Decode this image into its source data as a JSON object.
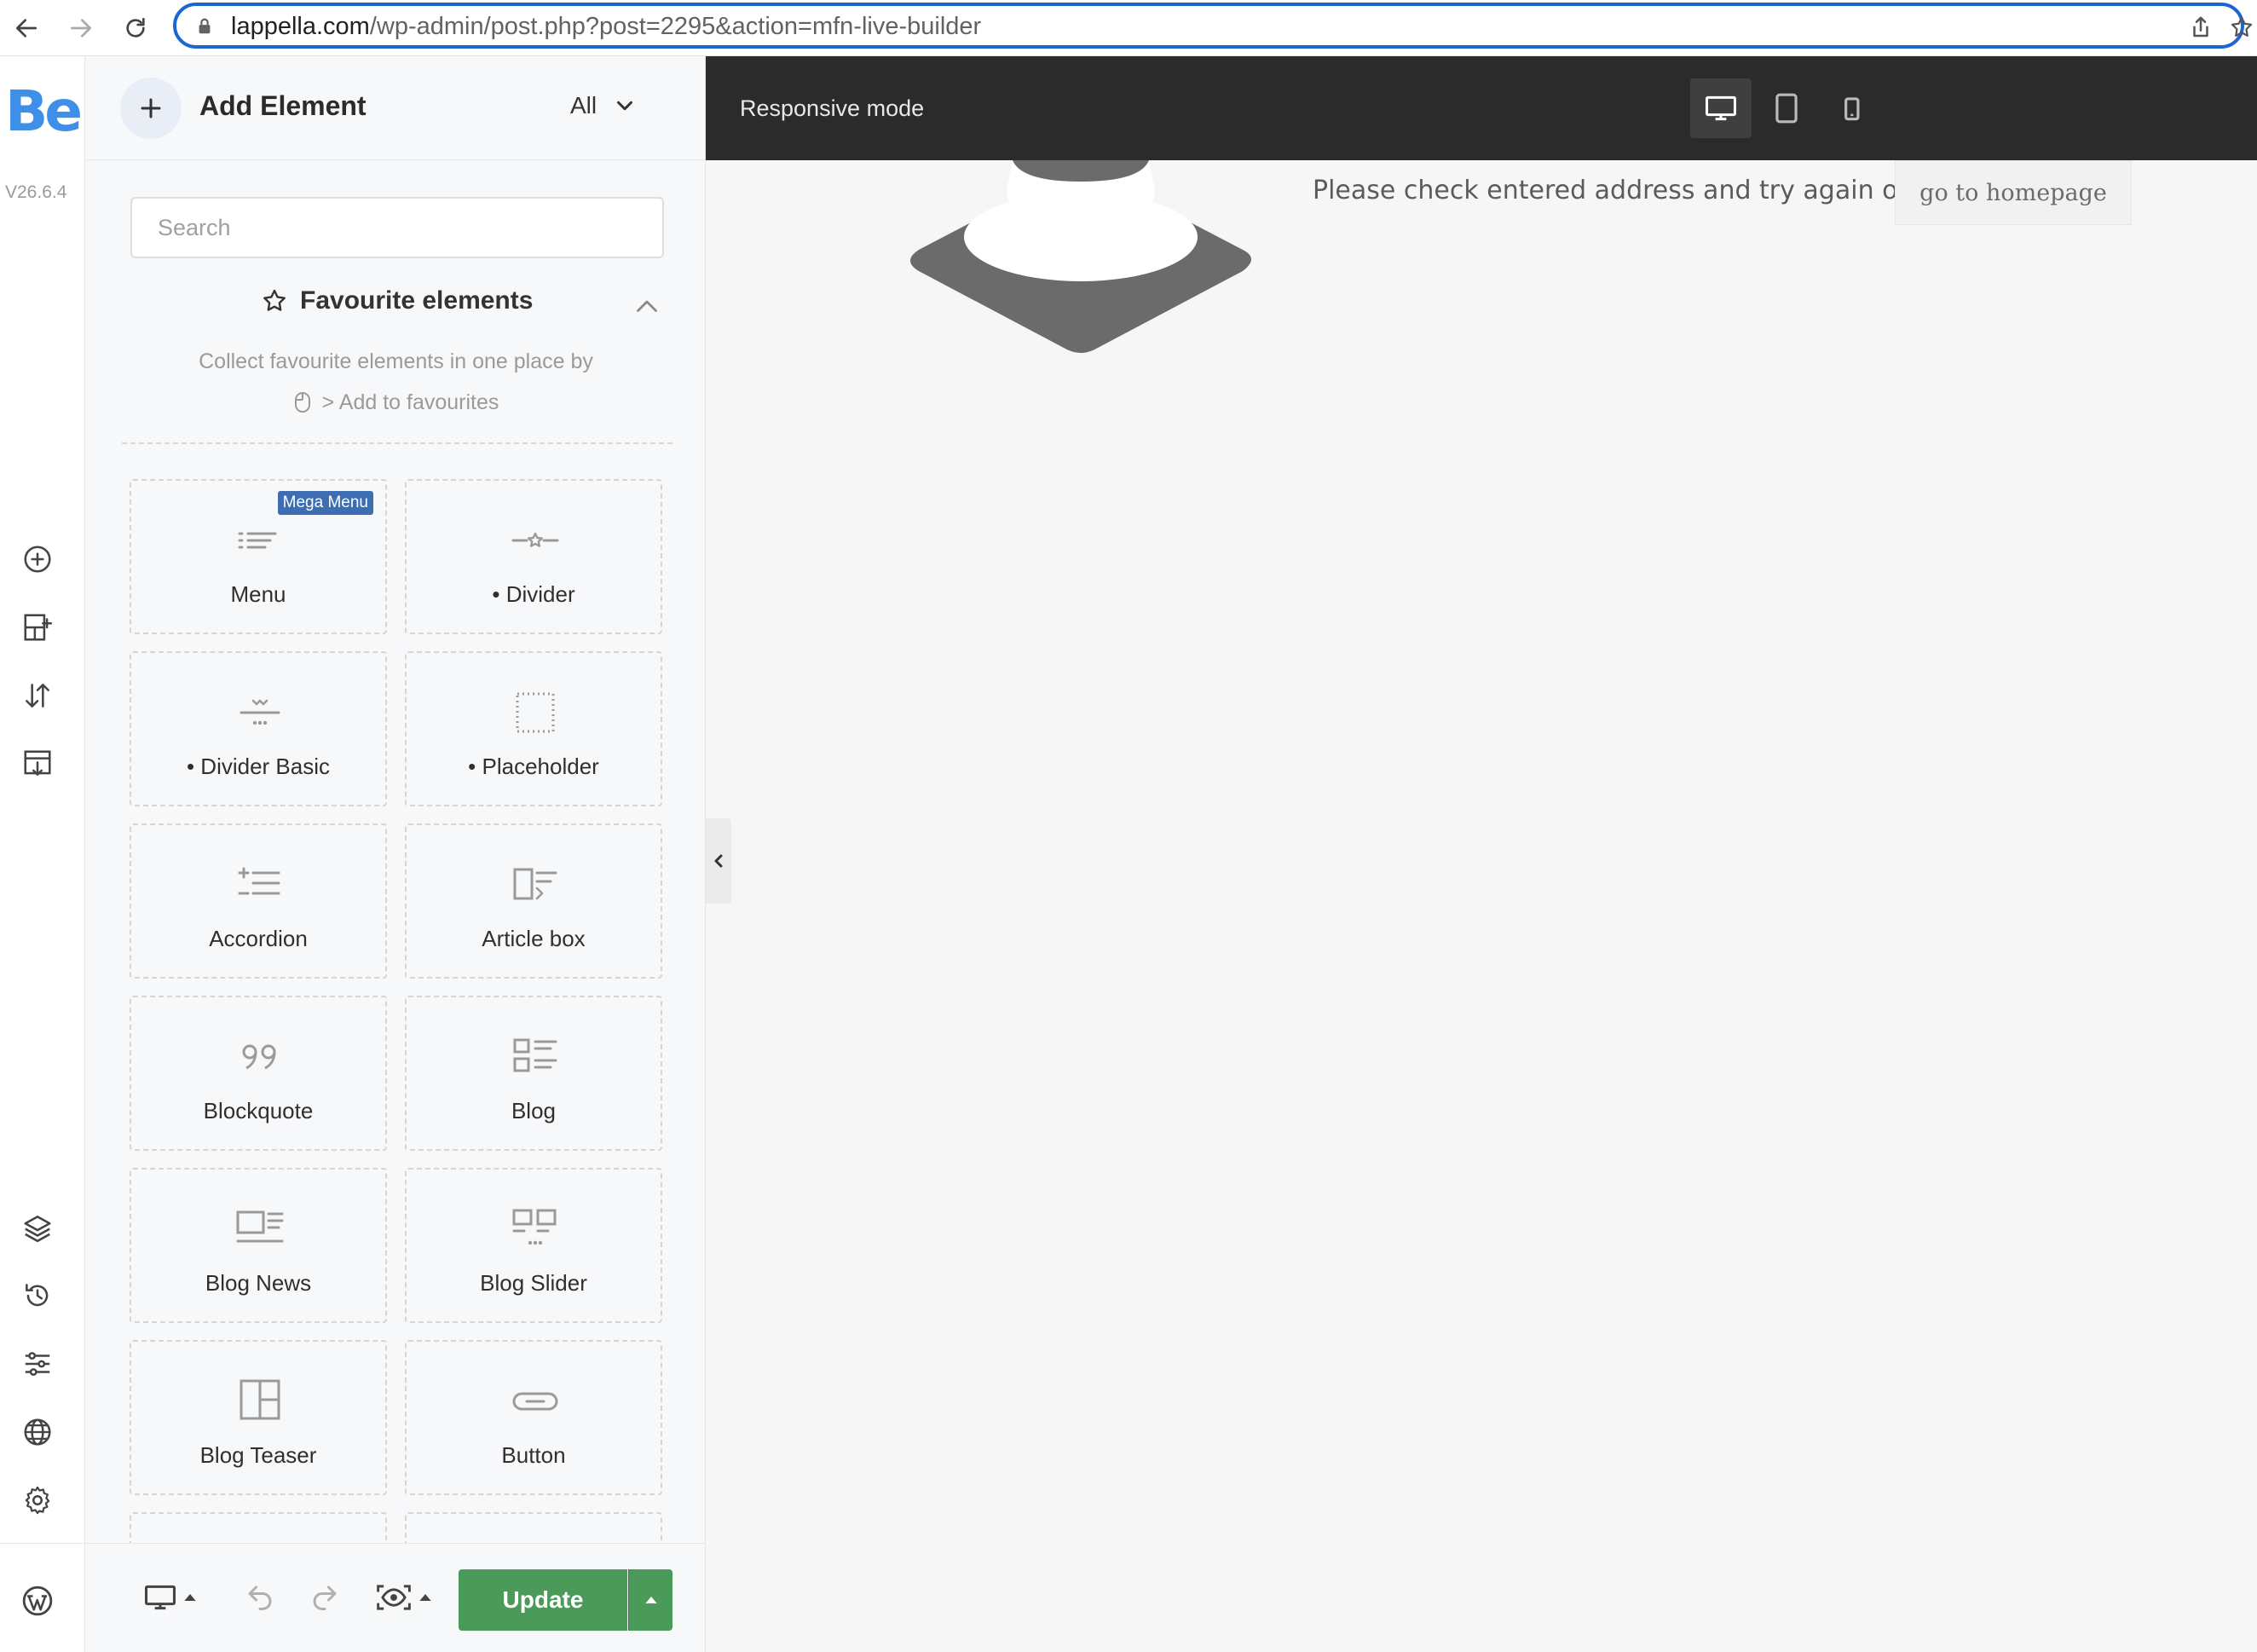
{
  "browser": {
    "url_host": "lappella.com",
    "url_path": "/wp-admin/post.php?post=2295&action=mfn-live-builder"
  },
  "rail": {
    "logo": "Be",
    "version": "V26.6.4",
    "top_icons": [
      "add-circle-icon",
      "add-section-icon",
      "sort-icon",
      "import-template-icon"
    ],
    "bottom_icons": [
      "layers-icon",
      "history-icon",
      "settings-sliders-icon",
      "globe-icon",
      "gear-icon",
      "wordpress-icon"
    ]
  },
  "panel": {
    "title": "Add Element",
    "filter": "All",
    "search_placeholder": "Search",
    "favourites": {
      "title": "Favourite elements",
      "desc_line1": "Collect favourite elements in one place by",
      "desc_line2": "> Add to favourites"
    },
    "elements": [
      {
        "label": "Menu",
        "badge": "Mega Menu",
        "icon": "menu-list-icon"
      },
      {
        "label": "• Divider",
        "icon": "divider-star-icon"
      },
      {
        "label": "• Divider Basic",
        "icon": "divider-basic-icon"
      },
      {
        "label": "• Placeholder",
        "icon": "placeholder-icon"
      },
      {
        "label": "Accordion",
        "icon": "accordion-icon"
      },
      {
        "label": "Article box",
        "icon": "article-box-icon"
      },
      {
        "label": "Blockquote",
        "icon": "blockquote-icon"
      },
      {
        "label": "Blog",
        "icon": "blog-icon"
      },
      {
        "label": "Blog News",
        "icon": "blog-news-icon"
      },
      {
        "label": "Blog Slider",
        "icon": "blog-slider-icon"
      },
      {
        "label": "Blog Teaser",
        "icon": "blog-teaser-icon"
      },
      {
        "label": "Button",
        "icon": "button-icon"
      }
    ]
  },
  "bottom_bar": {
    "update_label": "Update"
  },
  "preview": {
    "responsive_label": "Responsive mode",
    "error_message": "Please check entered address and try again or",
    "home_button": "go to homepage"
  },
  "colors": {
    "accent": "#3d8fe8",
    "update_green": "#4b9a5a",
    "badge_blue": "#3d6db3",
    "dark_bar": "#2b2b2b"
  }
}
